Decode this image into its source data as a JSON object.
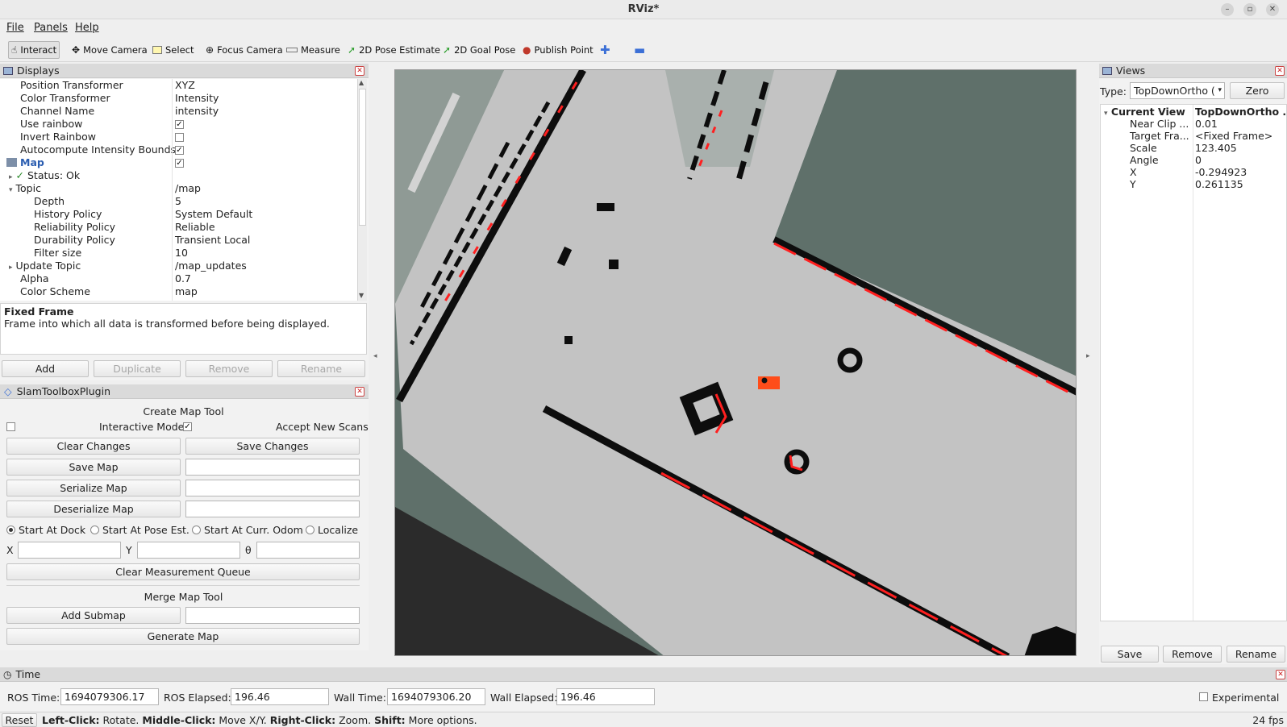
{
  "window": {
    "title": "RViz*"
  },
  "menu": {
    "file": "File",
    "panels": "Panels",
    "help": "Help"
  },
  "toolbar": {
    "interact": "Interact",
    "move_camera": "Move Camera",
    "select": "Select",
    "focus_camera": "Focus Camera",
    "measure": "Measure",
    "pose_estimate": "2D Pose Estimate",
    "goal_pose": "2D Goal Pose",
    "publish_point": "Publish Point"
  },
  "displays": {
    "title": "Displays",
    "rows": [
      {
        "name": "Position Transformer",
        "value": "XYZ"
      },
      {
        "name": "Color Transformer",
        "value": "Intensity"
      },
      {
        "name": "Channel Name",
        "value": "intensity"
      },
      {
        "name": "Use rainbow",
        "value": "✓"
      },
      {
        "name": "Invert Rainbow",
        "value": ""
      },
      {
        "name": "Autocompute Intensity Bounds",
        "value": "✓"
      },
      {
        "name": "Map",
        "value": "✓"
      },
      {
        "name": "Status: Ok",
        "value": ""
      },
      {
        "name": "Topic",
        "value": "/map"
      },
      {
        "name": "Depth",
        "value": "5"
      },
      {
        "name": "History Policy",
        "value": "System Default"
      },
      {
        "name": "Reliability Policy",
        "value": "Reliable"
      },
      {
        "name": "Durability Policy",
        "value": "Transient Local"
      },
      {
        "name": "Filter size",
        "value": "10"
      },
      {
        "name": "Update Topic",
        "value": "/map_updates"
      },
      {
        "name": "Alpha",
        "value": "0.7"
      },
      {
        "name": "Color Scheme",
        "value": "map"
      }
    ],
    "desc_title": "Fixed Frame",
    "desc_text": "Frame into which all data is transformed before being displayed.",
    "buttons": {
      "add": "Add",
      "duplicate": "Duplicate",
      "remove": "Remove",
      "rename": "Rename"
    }
  },
  "slam": {
    "title": "SlamToolboxPlugin",
    "create_map_tool": "Create Map Tool",
    "interactive_mode": "Interactive Mode",
    "accept_new_scans": "Accept New Scans",
    "clear_changes": "Clear Changes",
    "save_changes": "Save Changes",
    "save_map": "Save Map",
    "serialize_map": "Serialize Map",
    "deserialize_map": "Deserialize Map",
    "start_at_dock": "Start At Dock",
    "start_at_pose": "Start At Pose Est.",
    "start_at_odom": "Start At Curr. Odom",
    "localize": "Localize",
    "x": "X",
    "y": "Y",
    "theta": "θ",
    "clear_queue": "Clear Measurement Queue",
    "merge_map_tool": "Merge Map Tool",
    "add_submap": "Add Submap",
    "generate_map": "Generate Map"
  },
  "views": {
    "title": "Views",
    "type_label": "Type:",
    "type_value": "TopDownOrtho (",
    "zero": "Zero",
    "current_view": "Current View",
    "current_view_value": "TopDownOrtho ...",
    "props": [
      {
        "name": "Near Clip ...",
        "value": "0.01"
      },
      {
        "name": "Target Fra...",
        "value": "<Fixed Frame>"
      },
      {
        "name": "Scale",
        "value": "123.405"
      },
      {
        "name": "Angle",
        "value": "0"
      },
      {
        "name": "X",
        "value": "-0.294923"
      },
      {
        "name": "Y",
        "value": "0.261135"
      }
    ],
    "save": "Save",
    "remove": "Remove",
    "rename": "Rename"
  },
  "time": {
    "title": "Time",
    "ros_time_label": "ROS Time:",
    "ros_time": "1694079306.17",
    "ros_elapsed_label": "ROS Elapsed:",
    "ros_elapsed": "196.46",
    "wall_time_label": "Wall Time:",
    "wall_time": "1694079306.20",
    "wall_elapsed_label": "Wall Elapsed:",
    "wall_elapsed": "196.46",
    "experimental": "Experimental"
  },
  "status": {
    "reset": "Reset",
    "left_click": "Left-Click:",
    "rotate": " Rotate. ",
    "middle_click": "Middle-Click:",
    "move": " Move X/Y. ",
    "right_click": "Right-Click:",
    "zoom": " Zoom. ",
    "shift": "Shift:",
    "more": " More options.",
    "fps": "24 fps"
  },
  "colors": {
    "unknown": "#5f706a",
    "free": "#c3c3c3",
    "wall": "#0d0d0d",
    "scan": "#ff1f1f",
    "robot": "#ff4d1a"
  }
}
